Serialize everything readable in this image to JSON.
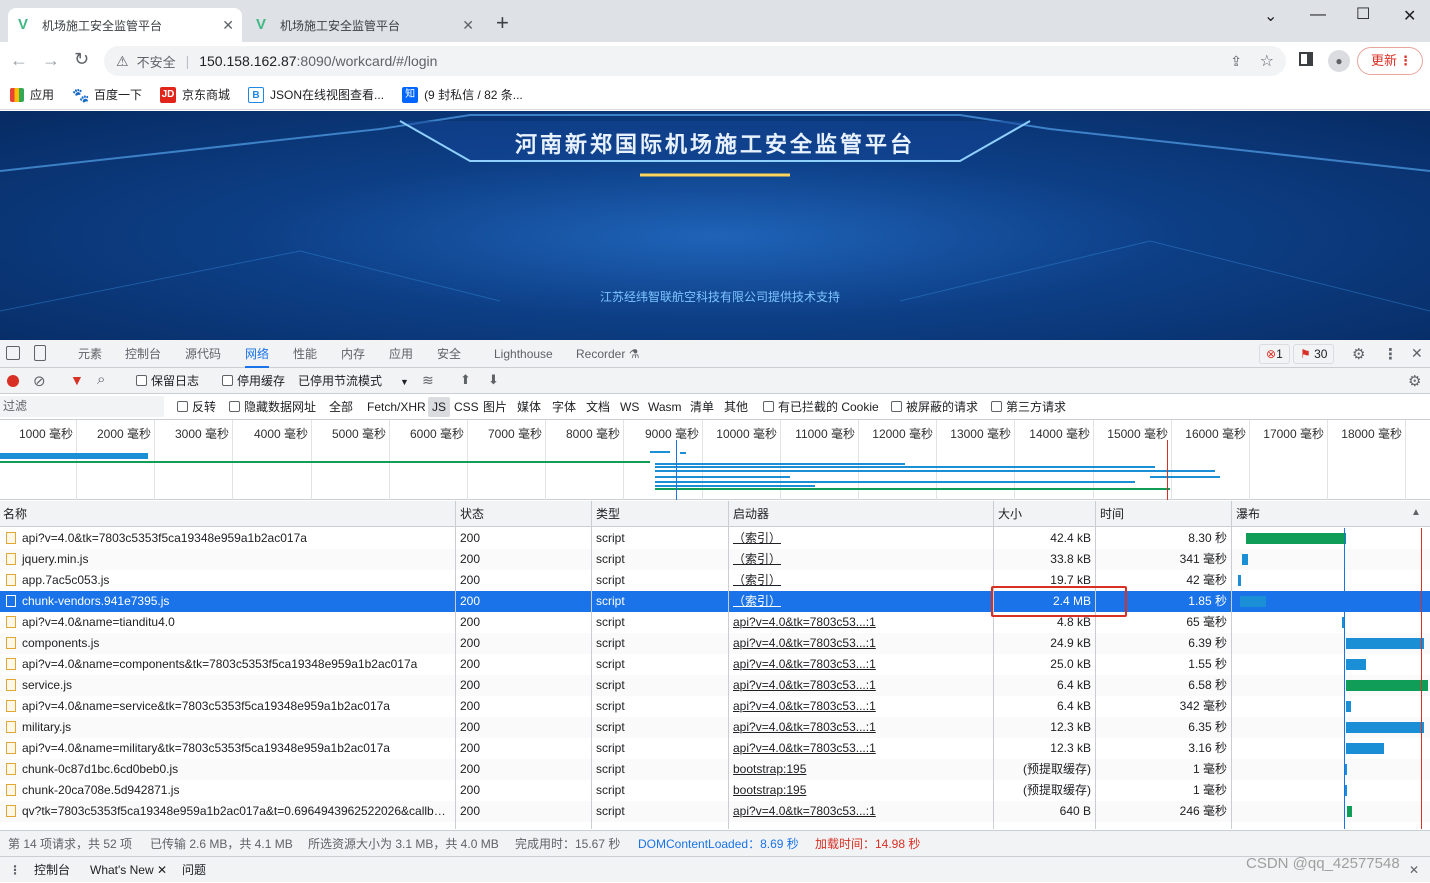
{
  "browser": {
    "tabs": [
      {
        "title": "机场施工安全监管平台",
        "active": true
      },
      {
        "title": "机场施工安全监管平台",
        "active": false
      }
    ],
    "new_tab": "+",
    "address": {
      "security_label": "不安全",
      "url_host": "150.158.162.87",
      "url_rest": ":8090/workcard/#/login"
    },
    "update_label": "更新",
    "bookmarks": [
      {
        "label": "应用",
        "icon": "apps-grid-icon"
      },
      {
        "label": "百度一下",
        "icon": "baidu-icon"
      },
      {
        "label": "京东商城",
        "icon": "jd-icon",
        "icon_text": "JD"
      },
      {
        "label": "JSON在线视图查看...",
        "icon": "json-icon",
        "icon_text": "B"
      },
      {
        "label": "(9 封私信 / 82 条...",
        "icon": "zhihu-icon",
        "icon_text": "知"
      }
    ]
  },
  "page": {
    "title": "河南新郑国际机场施工安全监管平台",
    "support_text": "江苏经纬智联航空科技有限公司提供技术支持"
  },
  "devtools": {
    "tabs": [
      "元素",
      "控制台",
      "源代码",
      "网络",
      "性能",
      "内存",
      "应用",
      "安全",
      "Lighthouse",
      "Recorder"
    ],
    "active_tab": "网络",
    "error_count": "1",
    "warning_count": "30",
    "toolbar": {
      "preserve_log": "保留日志",
      "disable_cache": "停用缓存",
      "throttling": "已停用节流模式"
    },
    "filter": {
      "placeholder": "过滤",
      "invert": "反转",
      "hide_data_urls": "隐藏数据网址",
      "types": [
        "全部",
        "Fetch/XHR",
        "JS",
        "CSS",
        "图片",
        "媒体",
        "字体",
        "文档",
        "WS",
        "Wasm",
        "清单",
        "其他"
      ],
      "active_type": "JS",
      "blocked_cookies": "有已拦截的 Cookie",
      "blocked_requests": "被屏蔽的请求",
      "third_party": "第三方请求"
    },
    "timeline_ticks": [
      "1000 毫秒",
      "2000 毫秒",
      "3000 毫秒",
      "4000 毫秒",
      "5000 毫秒",
      "6000 毫秒",
      "7000 毫秒",
      "8000 毫秒",
      "9000 毫秒",
      "10000 毫秒",
      "11000 毫秒",
      "12000 毫秒",
      "13000 毫秒",
      "14000 毫秒",
      "15000 毫秒",
      "16000 毫秒",
      "17000 毫秒",
      "18000 毫秒",
      "19"
    ],
    "columns": {
      "name": "名称",
      "status": "状态",
      "type": "类型",
      "initiator": "启动器",
      "size": "大小",
      "time": "时间",
      "waterfall": "瀑布"
    },
    "rows": [
      {
        "name": "api?v=4.0&tk=7803c5353f5ca19348e959a1b2ac017a",
        "status": "200",
        "type": "script",
        "initiator": "（索引）",
        "size": "42.4 kB",
        "time": "8.30 秒"
      },
      {
        "name": "jquery.min.js",
        "status": "200",
        "type": "script",
        "initiator": "（索引）",
        "size": "33.8 kB",
        "time": "341 毫秒"
      },
      {
        "name": "app.7ac5c053.js",
        "status": "200",
        "type": "script",
        "initiator": "（索引）",
        "size": "19.7 kB",
        "time": "42 毫秒"
      },
      {
        "name": "chunk-vendors.941e7395.js",
        "status": "200",
        "type": "script",
        "initiator": "（索引）",
        "size": "2.4 MB",
        "time": "1.85 秒",
        "selected": true
      },
      {
        "name": "api?v=4.0&name=tianditu4.0",
        "status": "200",
        "type": "script",
        "initiator": "api?v=4.0&tk=7803c53...:1",
        "size": "4.8 kB",
        "time": "65 毫秒"
      },
      {
        "name": "components.js",
        "status": "200",
        "type": "script",
        "initiator": "api?v=4.0&tk=7803c53...:1",
        "size": "24.9 kB",
        "time": "6.39 秒"
      },
      {
        "name": "api?v=4.0&name=components&tk=7803c5353f5ca19348e959a1b2ac017a",
        "status": "200",
        "type": "script",
        "initiator": "api?v=4.0&tk=7803c53...:1",
        "size": "25.0 kB",
        "time": "1.55 秒"
      },
      {
        "name": "service.js",
        "status": "200",
        "type": "script",
        "initiator": "api?v=4.0&tk=7803c53...:1",
        "size": "6.4 kB",
        "time": "6.58 秒"
      },
      {
        "name": "api?v=4.0&name=service&tk=7803c5353f5ca19348e959a1b2ac017a",
        "status": "200",
        "type": "script",
        "initiator": "api?v=4.0&tk=7803c53...:1",
        "size": "6.4 kB",
        "time": "342 毫秒"
      },
      {
        "name": "military.js",
        "status": "200",
        "type": "script",
        "initiator": "api?v=4.0&tk=7803c53...:1",
        "size": "12.3 kB",
        "time": "6.35 秒"
      },
      {
        "name": "api?v=4.0&name=military&tk=7803c5353f5ca19348e959a1b2ac017a",
        "status": "200",
        "type": "script",
        "initiator": "api?v=4.0&tk=7803c53...:1",
        "size": "12.3 kB",
        "time": "3.16 秒"
      },
      {
        "name": "chunk-0c87d1bc.6cd0beb0.js",
        "status": "200",
        "type": "script",
        "initiator": "bootstrap:195",
        "size": "(预提取缓存)",
        "time": "1 毫秒"
      },
      {
        "name": "chunk-20ca708e.5d942871.js",
        "status": "200",
        "type": "script",
        "initiator": "bootstrap:195",
        "size": "(预提取缓存)",
        "time": "1 毫秒"
      },
      {
        "name": "qv?tk=7803c5353f5ca19348e959a1b2ac017a&t=0.6964943962522026&callbac...",
        "status": "200",
        "type": "script",
        "initiator": "api?v=4.0&tk=7803c53...:1",
        "size": "640 B",
        "time": "246 毫秒"
      }
    ],
    "status": {
      "requests": "第 14 项请求，共 52 项",
      "transferred": "已传输 2.6 MB，共 4.1 MB",
      "resources": "所选资源大小为 3.1 MB，共 4.0 MB",
      "finish": "完成用时：15.67 秒",
      "dcl": "DOMContentLoaded：8.69 秒",
      "load": "加载时间：14.98 秒"
    },
    "drawer_tabs": [
      "控制台",
      "What's New",
      "问题"
    ]
  },
  "watermark": "CSDN @qq_42577548",
  "colors": {
    "accent": "#1a73e8",
    "waterfall_blue": "#1a8fd6",
    "waterfall_green": "#0f9d58",
    "highlight_box": "#d93025",
    "load_red": "#d93025",
    "dcl_blue": "#1a73e8"
  }
}
